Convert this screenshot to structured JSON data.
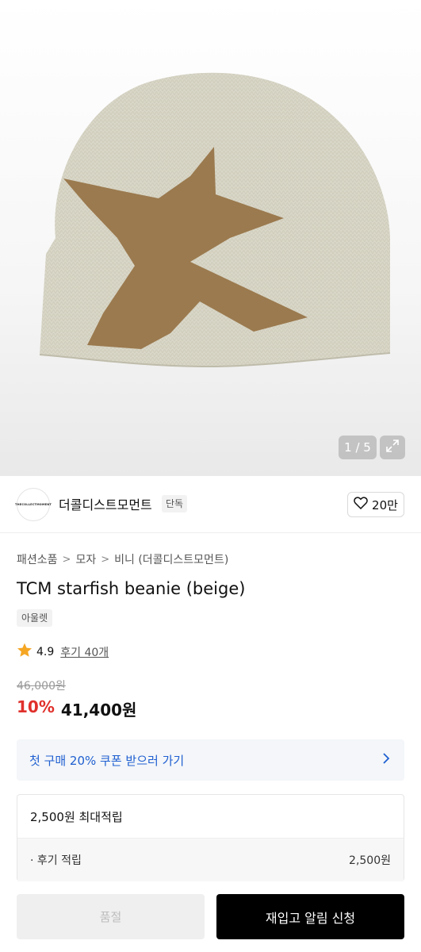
{
  "gallery": {
    "counter": "1 / 5",
    "expand_icon": "expand-icon",
    "product_colors": {
      "beanie": "#d8d6c6",
      "starfish": "#9b7a4f"
    }
  },
  "brand": {
    "logo_text": "THECOLLECTMOMENT",
    "name": "더콜디스트모먼트",
    "badge": "단독",
    "like_icon": "heart-icon",
    "like_count": "20만"
  },
  "breadcrumb": [
    "패션소품",
    "모자",
    "비니 (더콜디스트모먼트)"
  ],
  "product": {
    "title": "TCM starfish beanie (beige)",
    "tag": "아울렛",
    "rating": "4.9",
    "review_label": "후기 40개",
    "original_price": "46,000원",
    "discount": "10%",
    "price": "41,400원"
  },
  "coupon": {
    "label": "첫 구매 20% 쿠폰 받으러 가기",
    "icon": "chevron-right-icon"
  },
  "points": {
    "header": "2,500원 최대적립",
    "row_label": "· 후기 적립",
    "row_value": "2,500원"
  },
  "actions": {
    "soldout_label": "품절",
    "restock_label": "재입고 알림 신청"
  },
  "colors": {
    "discount": "#e0302b",
    "coupon_text": "#1f5fd1",
    "primary_button": "#000000"
  }
}
